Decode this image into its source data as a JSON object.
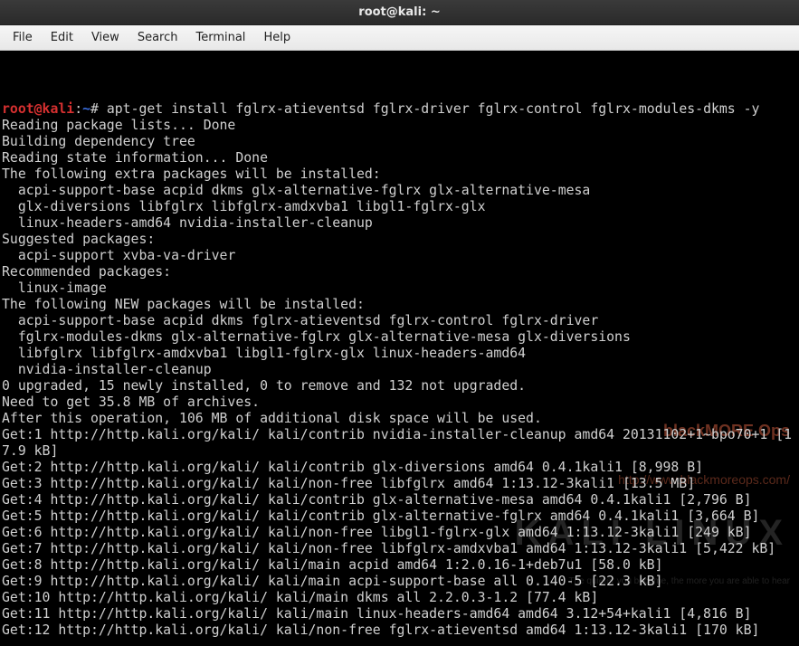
{
  "window": {
    "title": "root@kali: ~"
  },
  "menubar": {
    "items": [
      "File",
      "Edit",
      "View",
      "Search",
      "Terminal",
      "Help"
    ]
  },
  "prompt": {
    "user_host": "root@kali",
    "colon": ":",
    "cwd": "~",
    "symbol": "# "
  },
  "command": "apt-get install fglrx-atieventsd fglrx-driver fglrx-control fglrx-modules-dkms -y",
  "output_lines": [
    "Reading package lists... Done",
    "Building dependency tree",
    "Reading state information... Done",
    "The following extra packages will be installed:",
    "  acpi-support-base acpid dkms glx-alternative-fglrx glx-alternative-mesa",
    "  glx-diversions libfglrx libfglrx-amdxvba1 libgl1-fglrx-glx",
    "  linux-headers-amd64 nvidia-installer-cleanup",
    "Suggested packages:",
    "  acpi-support xvba-va-driver",
    "Recommended packages:",
    "  linux-image",
    "The following NEW packages will be installed:",
    "  acpi-support-base acpid dkms fglrx-atieventsd fglrx-control fglrx-driver",
    "  fglrx-modules-dkms glx-alternative-fglrx glx-alternative-mesa glx-diversions",
    "  libfglrx libfglrx-amdxvba1 libgl1-fglrx-glx linux-headers-amd64",
    "  nvidia-installer-cleanup",
    "0 upgraded, 15 newly installed, 0 to remove and 132 not upgraded.",
    "Need to get 35.8 MB of archives.",
    "After this operation, 106 MB of additional disk space will be used.",
    "Get:1 http://http.kali.org/kali/ kali/contrib nvidia-installer-cleanup amd64 20131102+1~bpo70+1 [17.9 kB]",
    "Get:2 http://http.kali.org/kali/ kali/contrib glx-diversions amd64 0.4.1kali1 [8,998 B]",
    "Get:3 http://http.kali.org/kali/ kali/non-free libfglrx amd64 1:13.12-3kali1 [13.5 MB]",
    "Get:4 http://http.kali.org/kali/ kali/contrib glx-alternative-mesa amd64 0.4.1kali1 [2,796 B]",
    "Get:5 http://http.kali.org/kali/ kali/contrib glx-alternative-fglrx amd64 0.4.1kali1 [3,664 B]",
    "Get:6 http://http.kali.org/kali/ kali/non-free libgl1-fglrx-glx amd64 1:13.12-3kali1 [249 kB]",
    "Get:7 http://http.kali.org/kali/ kali/non-free libfglrx-amdxvba1 amd64 1:13.12-3kali1 [5,422 kB]",
    "Get:8 http://http.kali.org/kali/ kali/main acpid amd64 1:2.0.16-1+deb7u1 [58.0 kB]",
    "Get:9 http://http.kali.org/kali/ kali/main acpi-support-base all 0.140-5 [22.3 kB]",
    "Get:10 http://http.kali.org/kali/ kali/main dkms all 2.2.0.3-1.2 [77.4 kB]",
    "Get:11 http://http.kali.org/kali/ kali/main linux-headers-amd64 amd64 3.12+54+kali1 [4,816 B]",
    "Get:12 http://http.kali.org/kali/ kali/non-free fglrx-atieventsd amd64 1:13.12-3kali1 [170 kB]"
  ],
  "watermark": {
    "line1": "blackMORE Ops",
    "line2": "http://www.blackmoreops.com/",
    "line3": "KALI LINUX",
    "line4": "The quieter you become, the more you are able to hear"
  }
}
